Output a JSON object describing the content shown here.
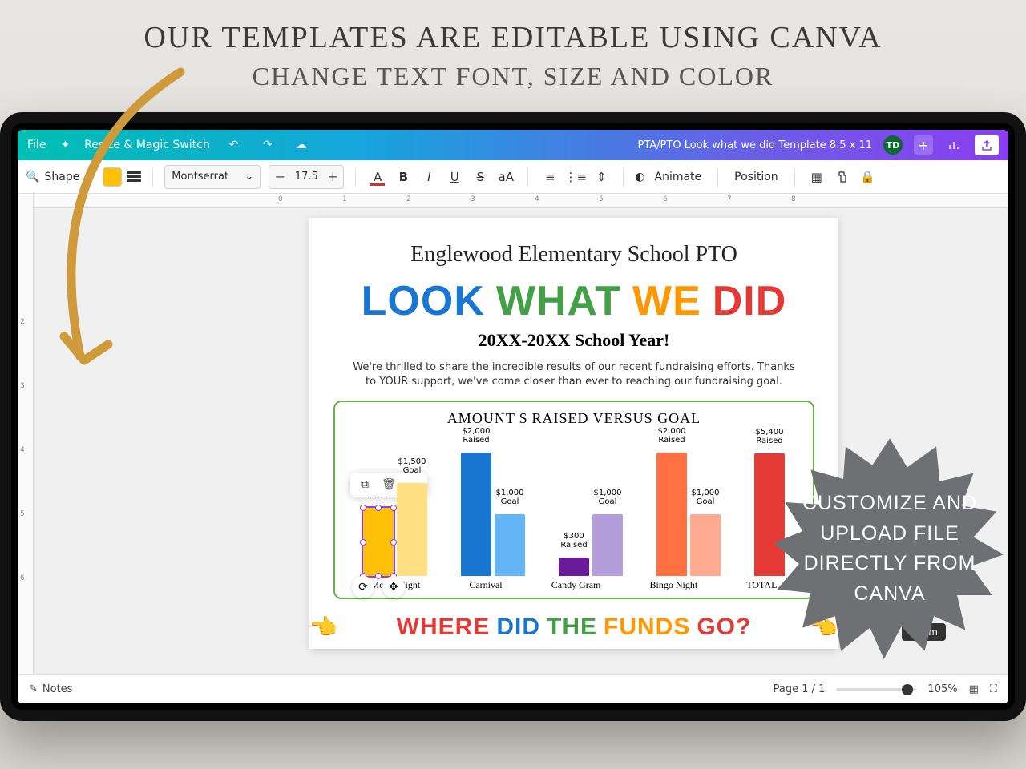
{
  "promo": {
    "line1": "OUR TEMPLATES ARE EDITABLE USING CANVA",
    "line2": "CHANGE TEXT FONT, SIZE AND COLOR"
  },
  "topbar": {
    "file": "File",
    "resize": "Resize & Magic Switch",
    "docTitle": "PTA/PTO Look what we did Template 8.5 x 11",
    "avatar": "TD"
  },
  "toolbar": {
    "shape": "Shape",
    "font": "Montserrat",
    "size": "17.5",
    "animate": "Animate",
    "position": "Position"
  },
  "page": {
    "schoolName": "Englewood Elementary School PTO",
    "title_words": [
      {
        "t": "LOOK",
        "c": "#1976d2"
      },
      {
        "t": "WHAT",
        "c": "#43a047"
      },
      {
        "t": "WE",
        "c": "#ff9800"
      },
      {
        "t": "DID",
        "c": "#e53935"
      }
    ],
    "subtitle": "20XX-20XX School Year!",
    "body": "We're thrilled to share the incredible results of our recent fundraising efforts. Thanks to YOUR support, we've come closer than ever to reaching our fundraising goal.",
    "chart_title": "AMOUNT $ RAISED VERSUS GOAL",
    "section2_words": [
      {
        "t": "WHERE",
        "c": "#e53935"
      },
      {
        "t": "DID",
        "c": "#1976d2"
      },
      {
        "t": "THE",
        "c": "#43a047"
      },
      {
        "t": "FUNDS",
        "c": "#ff9800"
      },
      {
        "t": "GO?",
        "c": "#e53935"
      }
    ]
  },
  "chart_data": {
    "type": "bar",
    "title": "AMOUNT $ RAISED VERSUS GOAL",
    "categories": [
      "Movie Night",
      "Carnival",
      "Candy Gram",
      "Bingo Night",
      "TOTAL"
    ],
    "series": [
      {
        "name": "Raised",
        "values": [
          1100,
          2000,
          300,
          2000,
          5400
        ],
        "labels": [
          "$1,100 Raised",
          "$2,000 Raised",
          "$300 Raised",
          "$2,000 Raised",
          "$5,400 Raised"
        ],
        "colors": [
          "#ffc107",
          "#1976d2",
          "#6a1b9a",
          "#ff7043",
          "#e53935"
        ]
      },
      {
        "name": "Goal",
        "values": [
          1500,
          1000,
          1000,
          1000,
          null
        ],
        "labels": [
          "$1,500 Goal",
          "$1,000 Goal",
          "$1,000 Goal",
          "$1,000 Goal",
          ""
        ],
        "colors": [
          "#ffe082",
          "#64b5f6",
          "#b39ddb",
          "#ffab91",
          ""
        ]
      }
    ],
    "ylim": [
      0,
      6000
    ]
  },
  "bottom": {
    "notes": "Notes",
    "page": "Page 1 / 1",
    "zoom": "105%",
    "zoomTip": "Zoom"
  },
  "starburst": {
    "l1": "CUSTOMIZE AND",
    "l2": "UPLOAD FILE",
    "l3": "DIRECTLY FROM",
    "l4": "CANVA"
  }
}
